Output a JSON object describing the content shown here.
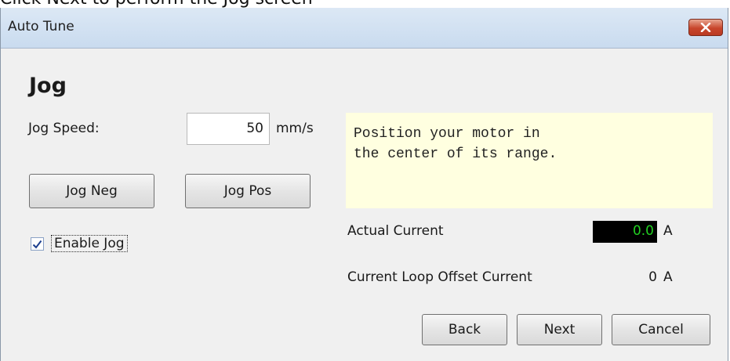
{
  "caption": "Click Next to perform the Jog screen",
  "window": {
    "title": "Auto Tune",
    "close_glyph": "✕"
  },
  "jog": {
    "heading": "Jog",
    "speed_label": "Jog Speed:",
    "speed_value": "50",
    "speed_unit": "mm/s",
    "neg_button": "Jog Neg",
    "pos_button": "Jog Pos",
    "enable_label": "Enable Jog",
    "enable_checked": true
  },
  "instruction": "Position your motor in\nthe center of its range.",
  "readings": {
    "actual_current_label": "Actual Current",
    "actual_current_value": "0.0",
    "actual_current_unit": "A",
    "offset_label": "Current Loop Offset Current",
    "offset_value": "0",
    "offset_unit": "A"
  },
  "footer": {
    "back": "Back",
    "next": "Next",
    "cancel": "Cancel"
  },
  "colors": {
    "readout_bg": "#000000",
    "readout_fg": "#22d022",
    "instruction_bg": "#ffffe0",
    "close_btn": "#c8462c"
  }
}
